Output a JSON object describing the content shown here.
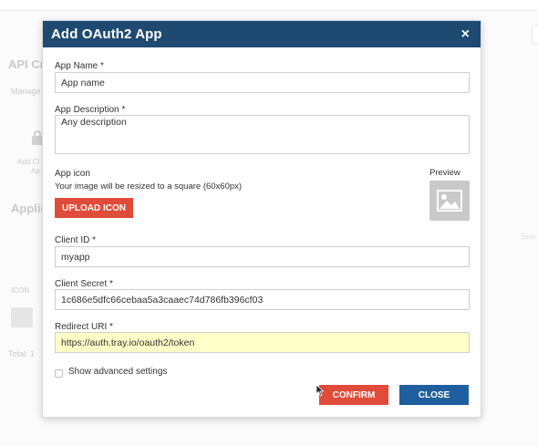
{
  "background": {
    "title": "API Cr",
    "subtitle": "Manage",
    "add_label_line1": "Add Cl",
    "add_label_line2": "Ap",
    "applications_heading": "Applic",
    "icon_column": "ICON",
    "total": "Total: 1",
    "search_hint": "Sear"
  },
  "modal": {
    "title": "Add OAuth2 App",
    "close_icon": "×",
    "fields": {
      "app_name": {
        "label": "App Name *",
        "value": "Ap‍p name"
      },
      "app_description": {
        "label": "App Description *",
        "value": "Any description"
      },
      "app_icon": {
        "label": "App icon",
        "hint": "Your image will be resized to a square (60x60px)",
        "upload_label": "UPLOAD ICON",
        "preview_label": "Preview"
      },
      "client_id": {
        "label": "Client ID *",
        "value": "myapp"
      },
      "client_secret": {
        "label": "Client Secret *",
        "value": "1c686e5dfc66cebaa5a3caaec74d786fb396cf03"
      },
      "redirect_uri": {
        "label": "Redirect URI *",
        "value": "https://auth.tray.io/oauth2/token"
      }
    },
    "advanced_settings_label": "Show advanced settings",
    "confirm_label": "CONFIRM",
    "close_label": "CLOSE"
  },
  "colors": {
    "header": "#1e4a72",
    "confirm": "#e04b3a",
    "close": "#1f5f9d",
    "highlight": "#ffffc8"
  },
  "icons": [
    "close-icon",
    "image-placeholder-icon",
    "lock-icon",
    "mouse-cursor-icon"
  ]
}
